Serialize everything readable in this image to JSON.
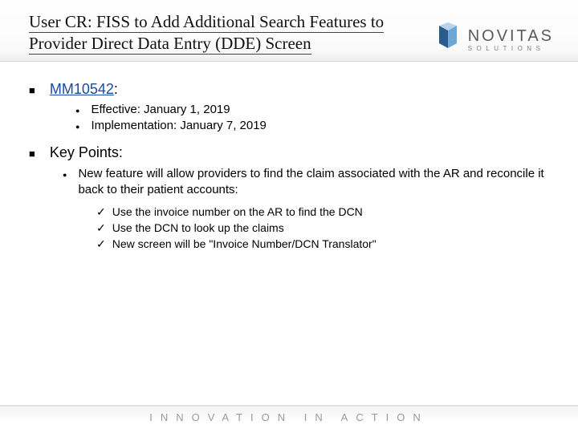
{
  "header": {
    "title": "User CR: FISS to Add Additional Search Features to Provider Direct Data Entry (DDE) Screen",
    "logo": {
      "main": "NOVITAS",
      "sub": "SOLUTIONS"
    }
  },
  "sections": [
    {
      "link": "MM10542",
      "colon": ":",
      "bullets": [
        "Effective: January 1, 2019",
        "Implementation: January 7, 2019"
      ]
    },
    {
      "label": "Key Points:",
      "desc": "New feature will allow providers to find the claim associated with the AR and reconcile it back to their patient accounts:",
      "checks": [
        "Use the invoice number on the AR to find the DCN",
        "Use the DCN to look up the claims",
        "New screen will be \"Invoice Number/DCN Translator\""
      ]
    }
  ],
  "footer": "INNOVATION IN ACTION"
}
